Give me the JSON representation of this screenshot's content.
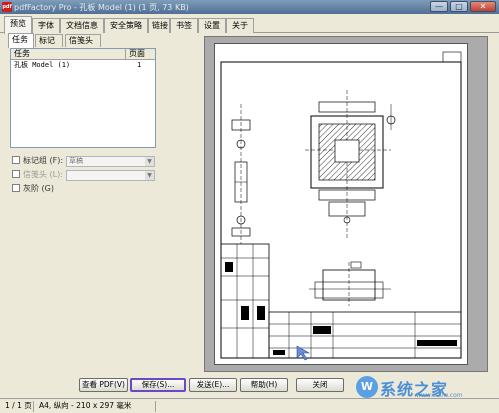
{
  "window": {
    "title": "pdfFactory Pro - 孔板 Model (1) (1 页, 73 KB)",
    "app_icon_text": "pdf",
    "minimize_glyph": "—",
    "maximize_glyph": "□",
    "close_glyph": "✕"
  },
  "tabs": [
    {
      "label": "预览",
      "active": true
    },
    {
      "label": "字体"
    },
    {
      "label": "文档信息"
    },
    {
      "label": "安全策略"
    },
    {
      "label": "链接"
    },
    {
      "label": "书签"
    },
    {
      "label": "设置"
    },
    {
      "label": "关于"
    }
  ],
  "subtabs": [
    {
      "label": "任务",
      "active": true
    },
    {
      "label": "标记"
    },
    {
      "label": "信笺头"
    }
  ],
  "task_list": {
    "columns": [
      "任务",
      "页面"
    ],
    "rows": [
      {
        "task": "孔板 Model (1)",
        "pages": "1"
      }
    ]
  },
  "options": {
    "mark_group": {
      "label": "标记组 (F):",
      "value": "草稿"
    },
    "letterhead": {
      "label": "信笺头 (L):",
      "value": ""
    },
    "grayscale": {
      "label": "灰阶 (G)"
    }
  },
  "buttons": {
    "view_pdf": "查看 PDF(V)",
    "save": "保存(S)...",
    "send": "发送(E)...",
    "help": "帮助(H)",
    "close": "关闭"
  },
  "status": {
    "pages": "1 / 1 页",
    "paper": "A4, 纵向 - 210 x 297 毫米"
  },
  "watermark": {
    "text": "系统之家",
    "url": "www.300w.com",
    "logo": "W"
  },
  "colors": {
    "accent_highlight": "#6a49c9",
    "preview_bg": "#ababab"
  }
}
